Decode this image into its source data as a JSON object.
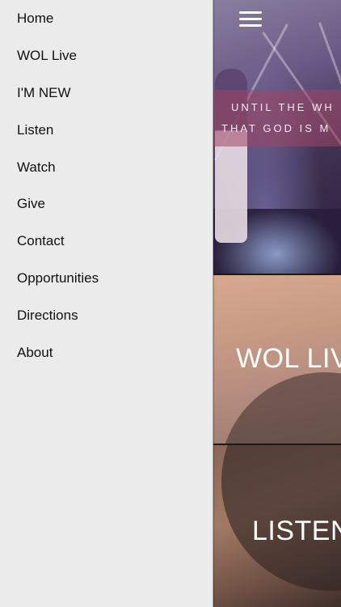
{
  "drawer": {
    "items": [
      {
        "label": "Home"
      },
      {
        "label": "WOL Live"
      },
      {
        "label": "I'M NEW"
      },
      {
        "label": "Listen"
      },
      {
        "label": "Watch"
      },
      {
        "label": "Give"
      },
      {
        "label": "Contact"
      },
      {
        "label": "Opportunities"
      },
      {
        "label": "Directions"
      },
      {
        "label": "About"
      }
    ]
  },
  "main": {
    "hamburger_icon": "hamburger-menu-icon",
    "hero": {
      "line1": "UNTIL THE WH",
      "line2": "THAT GOD IS M"
    },
    "live_label": "WOL LIVE",
    "listen_label": "LISTEN"
  }
}
